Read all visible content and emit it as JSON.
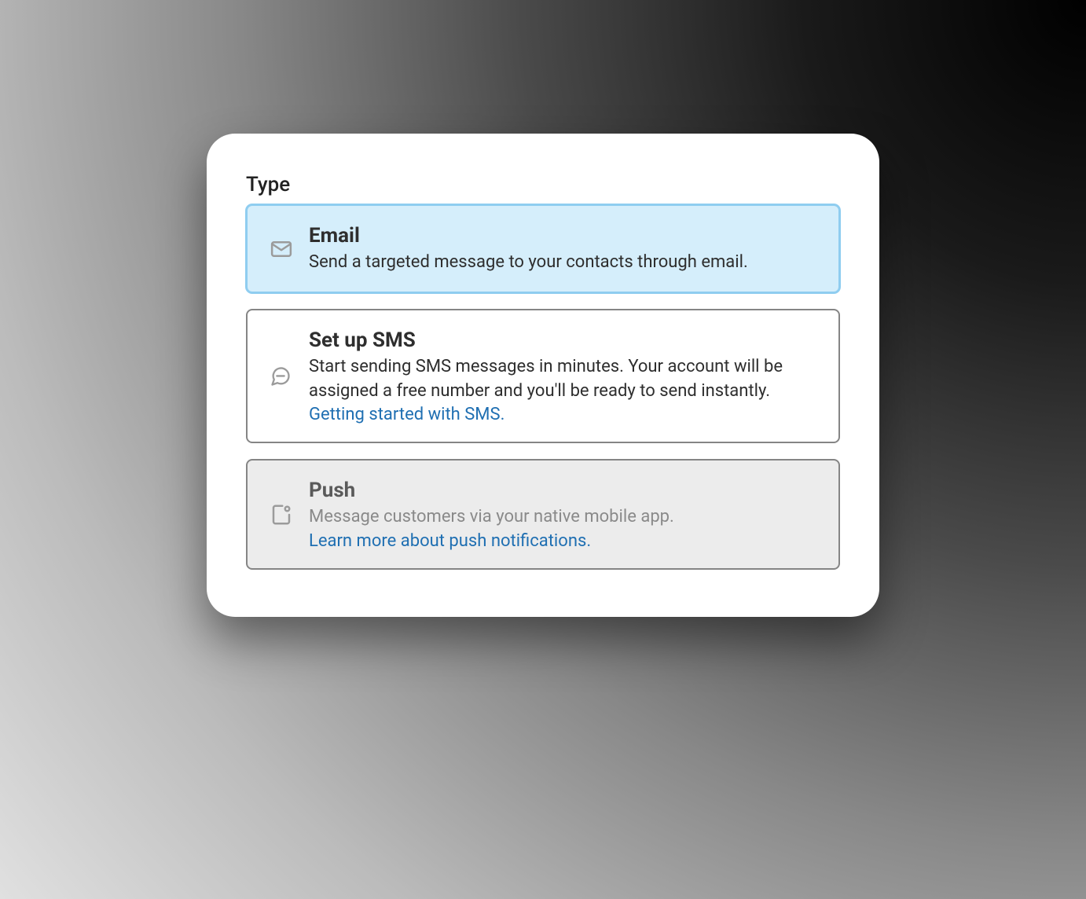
{
  "section": {
    "title": "Type"
  },
  "options": {
    "email": {
      "title": "Email",
      "description": "Send a targeted message to your contacts through email."
    },
    "sms": {
      "title": "Set up SMS",
      "description": "Start sending SMS messages in minutes. Your account will be assigned a free number and you'll be ready to send instantly.",
      "link": "Getting started with SMS."
    },
    "push": {
      "title": "Push",
      "description": "Message customers via your native mobile app.",
      "link": "Learn more about push notifications."
    }
  }
}
